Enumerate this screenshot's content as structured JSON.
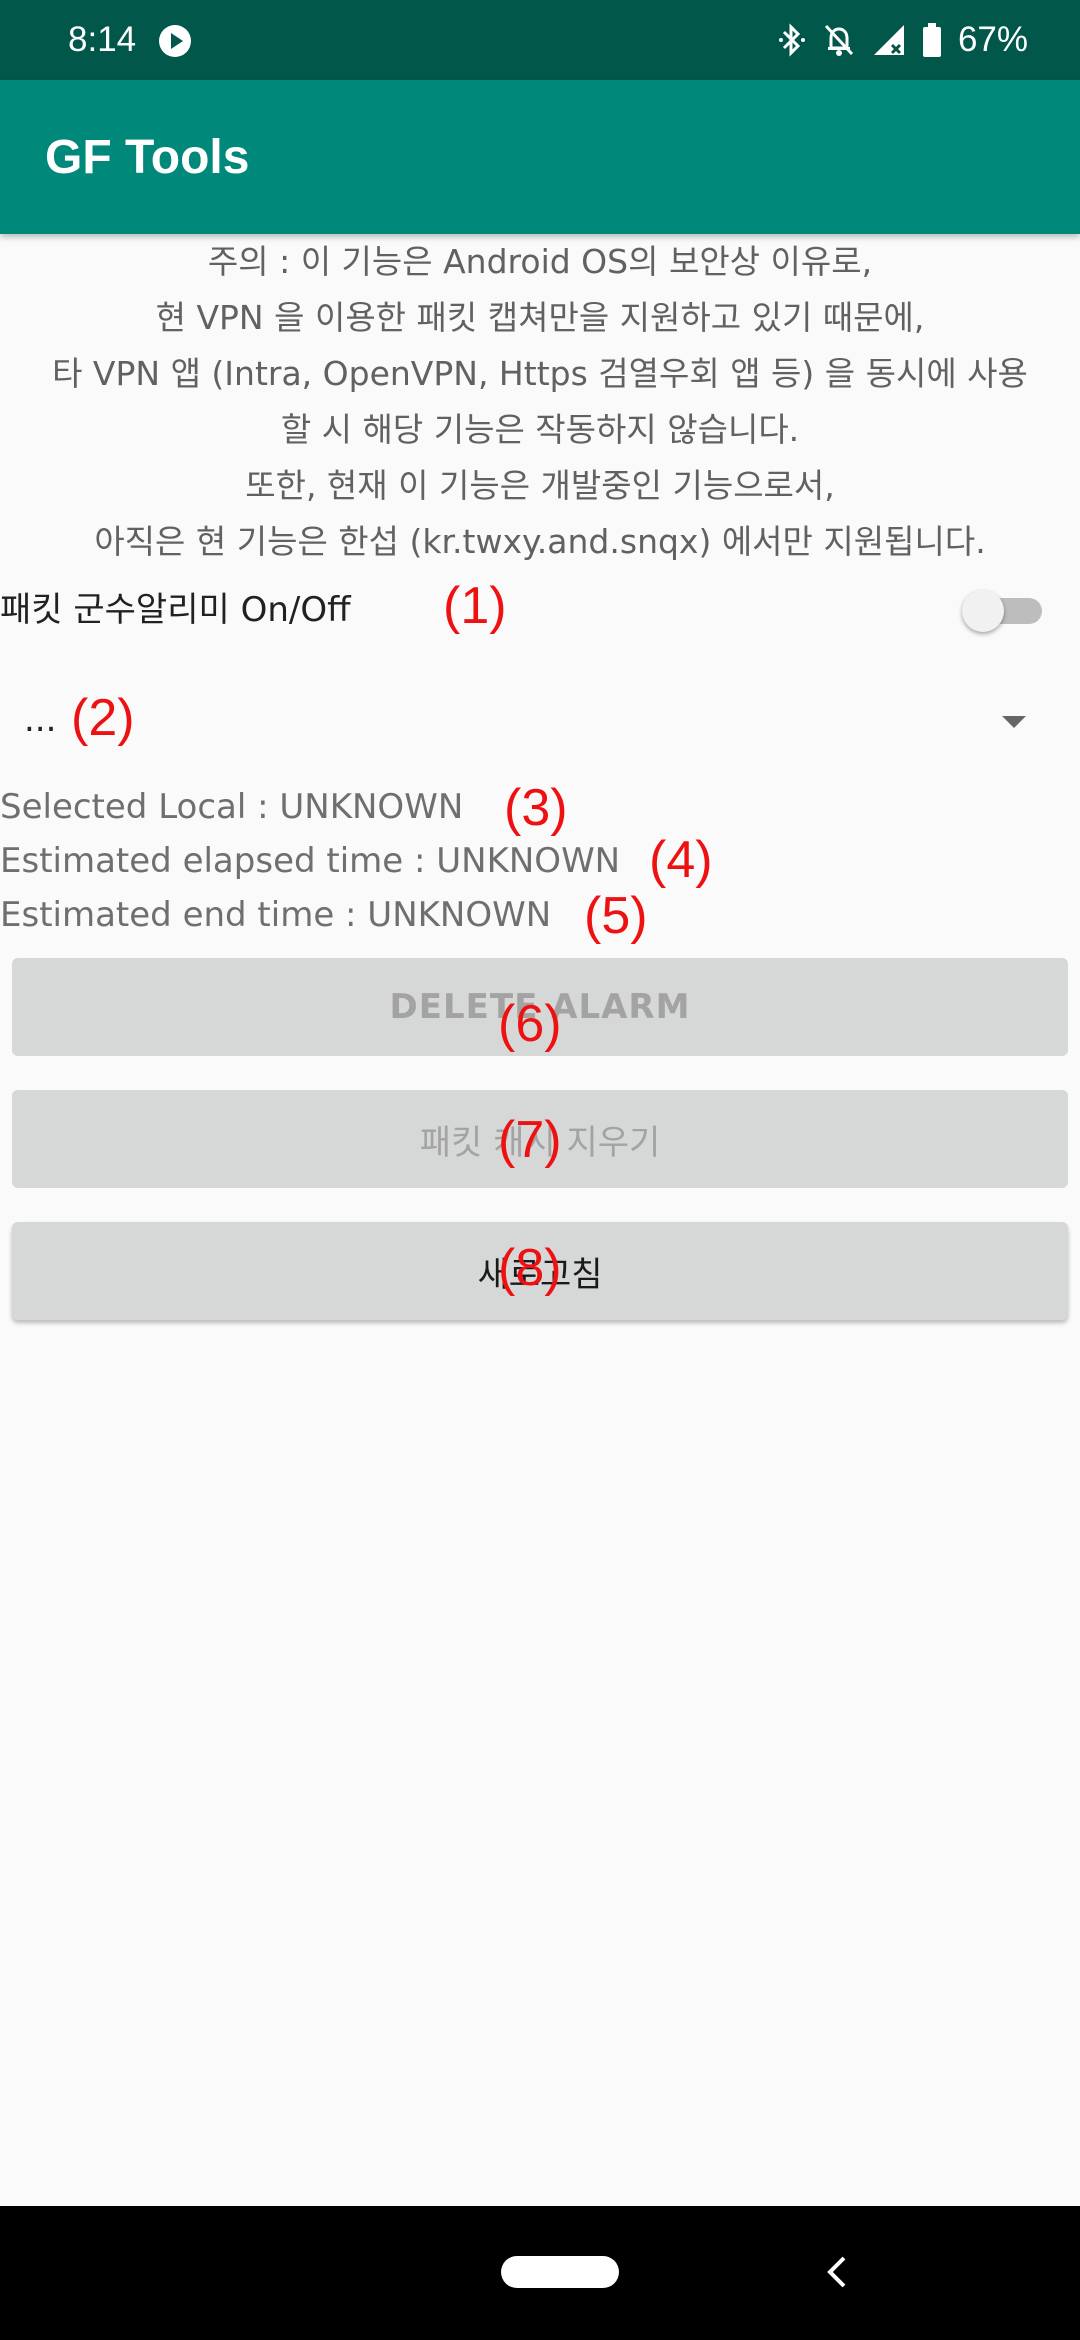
{
  "status_bar": {
    "time": "8:14",
    "battery": "67%",
    "icons": [
      "play-icon",
      "bluetooth-icon",
      "alarm-off-icon",
      "signal-icon",
      "battery-icon"
    ]
  },
  "app_bar": {
    "title": "GF Tools"
  },
  "notice": {
    "lines": [
      "주의 : 이 기능은 Android OS의 보안상 이유로,",
      "현 VPN 을 이용한 패킷 캡쳐만을 지원하고 있기 때문에,",
      "타 VPN 앱 (Intra, OpenVPN, Https 검열우회 앱 등) 을 동시에 사용",
      "할 시 해당 기능은 작동하지 않습니다.",
      "또한, 현재 이 기능은 개발중인 기능으로서,",
      "아직은 현 기능은 한섭 (kr.twxy.and.snqx) 에서만 지원됩니다."
    ]
  },
  "toggle": {
    "label": "패킷 군수알리미 On/Off",
    "state": "off"
  },
  "spinner": {
    "value": "..."
  },
  "info": {
    "selected_local": "Selected Local : UNKNOWN",
    "elapsed_time": "Estimated elapsed time : UNKNOWN",
    "end_time": "Estimated end time : UNKNOWN"
  },
  "buttons": {
    "delete_alarm": "DELETE ALARM",
    "clear_cache": "패킷 캐시 지우기",
    "refresh": "새로고침"
  },
  "annotations": [
    "(1)",
    "(2)",
    "(3)",
    "(4)",
    "(5)",
    "(6)",
    "(7)",
    "(8)"
  ],
  "colors": {
    "status_bar": "#00574a",
    "app_bar": "#00897b",
    "background": "#fafafa",
    "button": "#d6d7d7",
    "annotation": "#ee1111"
  }
}
